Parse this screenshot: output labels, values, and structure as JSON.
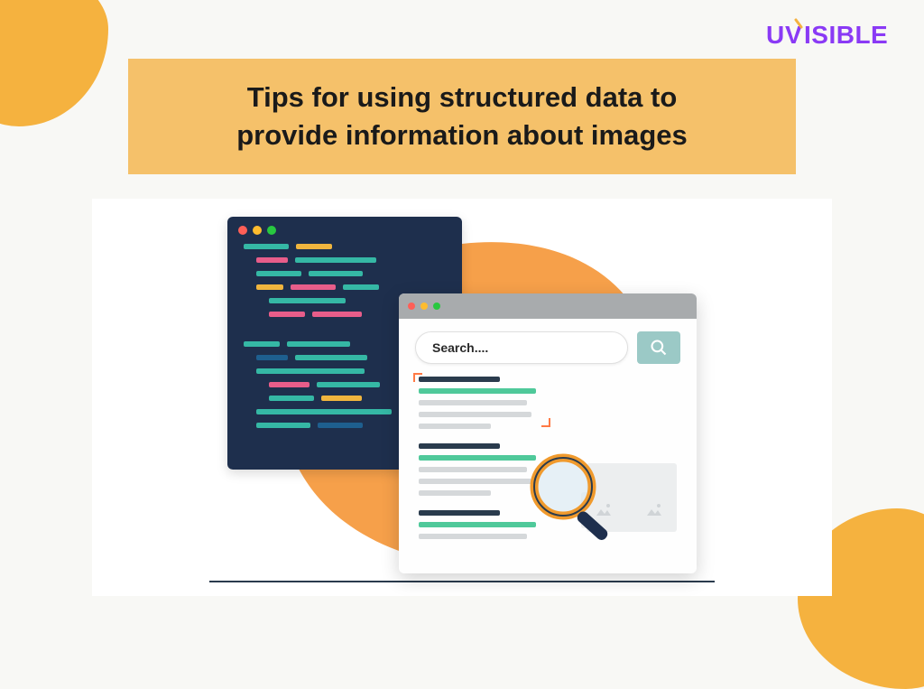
{
  "brand": {
    "name": "UVISIBLE"
  },
  "title": {
    "line1": "Tips for using structured data to",
    "line2": "provide information about images"
  },
  "browser": {
    "search_placeholder": "Search...."
  }
}
